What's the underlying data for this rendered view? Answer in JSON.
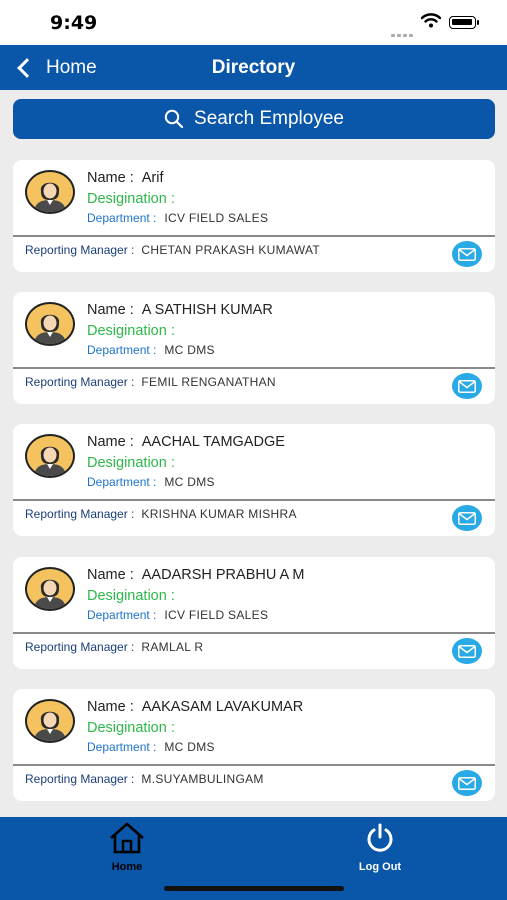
{
  "status_bar": {
    "time": "9:49"
  },
  "nav": {
    "back_label": "Home",
    "title": "Directory"
  },
  "search": {
    "label": "Search Employee"
  },
  "labels": {
    "name": "Name :",
    "designation": "Desigination :",
    "department": "Department :",
    "reporting_manager": "Reporting Manager :"
  },
  "employees": [
    {
      "name": "Arif",
      "designation": "",
      "department": "ICV FIELD SALES",
      "reporting_manager": "CHETAN PRAKASH KUMAWAT"
    },
    {
      "name": "A SATHISH KUMAR",
      "designation": "",
      "department": "MC DMS",
      "reporting_manager": "FEMIL RENGANATHAN"
    },
    {
      "name": "AACHAL TAMGADGE",
      "designation": "",
      "department": "MC DMS",
      "reporting_manager": "KRISHNA KUMAR MISHRA"
    },
    {
      "name": "AADARSH PRABHU A M",
      "designation": "",
      "department": "ICV FIELD SALES",
      "reporting_manager": "RAMLAL R"
    },
    {
      "name": "AAKASAM LAVAKUMAR",
      "designation": "",
      "department": "MC DMS",
      "reporting_manager": "M.SUYAMBULINGAM"
    }
  ],
  "tabs": {
    "home_label": "Home",
    "logout_label": "Log Out"
  },
  "icons": {
    "back": "chevron-left-icon",
    "search": "search-icon",
    "avatar": "avatar-icon",
    "mail": "mail-icon",
    "home": "home-icon",
    "power": "power-icon"
  },
  "colors": {
    "primary": "#0a56a8",
    "designation": "#2db84a",
    "department": "#1e73c9",
    "mail": "#29a9e6",
    "avatar_bg": "#f4c35f"
  }
}
